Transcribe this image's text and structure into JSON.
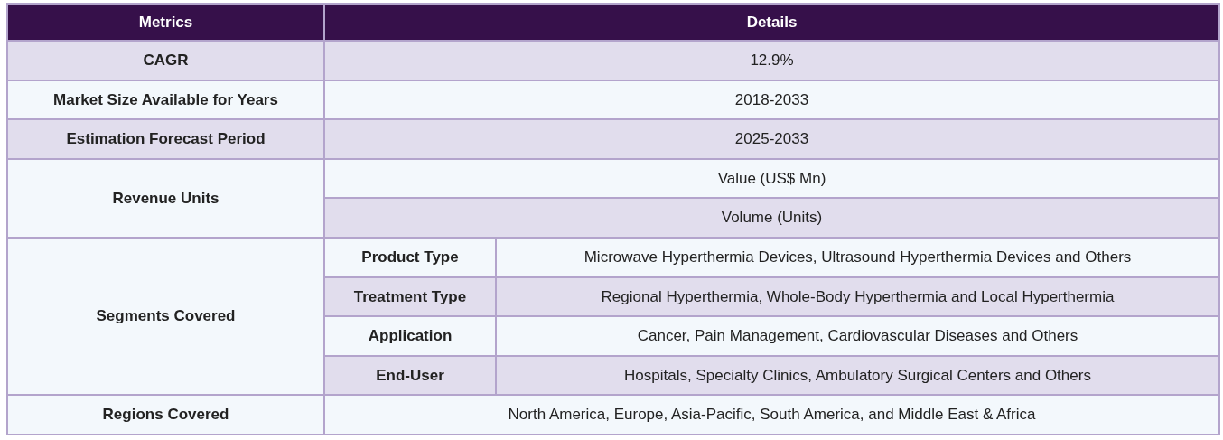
{
  "columns": [
    "Metrics",
    "Details"
  ],
  "rows": [
    {
      "kind": "simple",
      "metric": "CAGR",
      "detail": "12.9%"
    },
    {
      "kind": "simple",
      "metric": "Market Size Available for Years",
      "detail": "2018-2033"
    },
    {
      "kind": "simple",
      "metric": "Estimation Forecast Period",
      "detail": "2025-2033"
    },
    {
      "kind": "multi",
      "metric": "Revenue Units",
      "details": [
        "Value (US$ Mn)",
        "Volume (Units)"
      ]
    },
    {
      "kind": "segmented",
      "metric": "Segments Covered",
      "segments": [
        {
          "name": "Product Type",
          "detail": "Microwave Hyperthermia Devices, Ultrasound Hyperthermia Devices and Others"
        },
        {
          "name": "Treatment Type",
          "detail": "Regional Hyperthermia, Whole-Body Hyperthermia and Local Hyperthermia"
        },
        {
          "name": "Application",
          "detail": "Cancer, Pain Management, Cardiovascular Diseases and Others"
        },
        {
          "name": "End-User",
          "detail": "Hospitals, Specialty Clinics, Ambulatory Surgical Centers and Others"
        }
      ]
    },
    {
      "kind": "simple",
      "metric": "Regions Covered",
      "detail": "North America, Europe, Asia-Pacific, South America, and Middle East & Africa"
    }
  ]
}
